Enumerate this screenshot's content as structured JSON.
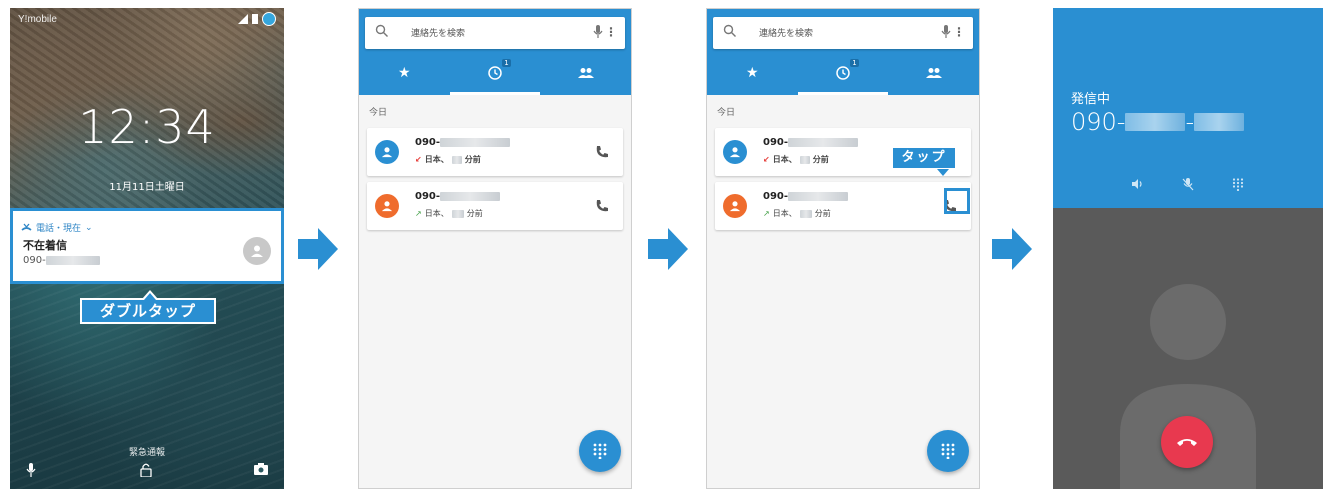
{
  "lock_screen": {
    "carrier": "Y!mobile",
    "time": "12:34",
    "date": "11月11日土曜日",
    "notification": {
      "source": "電話・現在",
      "title": "不在着信",
      "number_prefix": "090-"
    },
    "emergency_label": "緊急通報"
  },
  "callouts": {
    "double_tap": "ダブルタップ",
    "tap": "タップ"
  },
  "phone_app": {
    "search_placeholder": "連絡先を検索",
    "missed_badge": "1",
    "section_today": "今日",
    "entries": [
      {
        "number_prefix": "090-",
        "location": "日本、",
        "time_suffix": "分前",
        "type": "missed",
        "avatar_color": "#2a8fd2"
      },
      {
        "number_prefix": "090-",
        "location": "日本、",
        "time_suffix": "分前",
        "type": "outgoing",
        "avatar_color": "#ef6c2d"
      }
    ]
  },
  "calling_screen": {
    "status": "発信中",
    "number_prefix": "090-",
    "number_sep": "-"
  },
  "colors": {
    "accent": "#2a8fd2",
    "end_call": "#e8394f",
    "missed": "#e53935",
    "outgoing": "#43a047"
  }
}
